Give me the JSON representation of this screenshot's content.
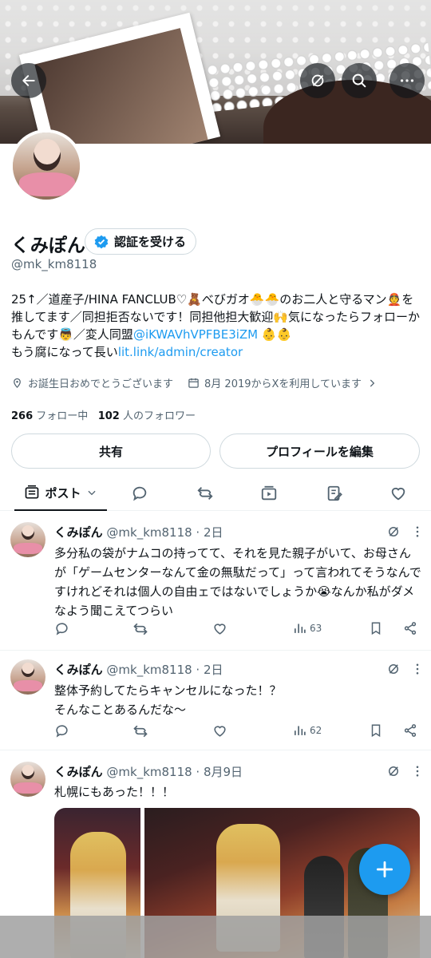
{
  "profile": {
    "name": "くみぽん",
    "verify_label": "認証を受ける",
    "handle": "@mk_km8118",
    "bio_line1": "25↑／道産子/HINA FANCLUB♡🧸べびガオ🐣🐣のお二人と守るマン👲を推してます／同担拒否ないです！同担他担大歓迎🙌気になったらフォローかもんです👼／変人同盟",
    "bio_mention": "@iKWAVhVPFBE3iZM",
    "bio_line1_tail": " 👶👶",
    "bio_line2_prefix": "もう腐になって長い",
    "bio_link": "lit.link/admin/creator",
    "birthday": "お誕生日おめでとうございます",
    "joined": "8月 2019からXを利用しています",
    "following_count": "266",
    "following_label": "フォロー中",
    "followers_count": "102",
    "followers_label": "人のフォロワー",
    "share_label": "共有",
    "edit_label": "プロフィールを編集"
  },
  "tabs": {
    "posts_label": "ポスト"
  },
  "posts": [
    {
      "author": "くみぽん",
      "meta": "@mk_km8118 · 2日",
      "text": "多分私の袋がナムコの持ってて、それを見た親子がいて、お母さんが「ゲームセンターなんて金の無駄だって」って言われてそうなんですけれどそれは個人の自由ェではないでしょうか😭なんか私がダメなよう聞こえてつらい",
      "views": "63"
    },
    {
      "author": "くみぽん",
      "meta": "@mk_km8118 · 2日",
      "text_line1": "整体予約してたらキャンセルになった！？",
      "text_line2": "そんなことあるんだな〜",
      "views": "62"
    },
    {
      "author": "くみぽん",
      "meta": "@mk_km8118 · 8月9日",
      "text": "札幌にもあった！！！"
    }
  ],
  "colors": {
    "accent": "#1d9bf0",
    "text": "#0f1419",
    "secondary": "#536471",
    "border": "#cfd9de"
  }
}
